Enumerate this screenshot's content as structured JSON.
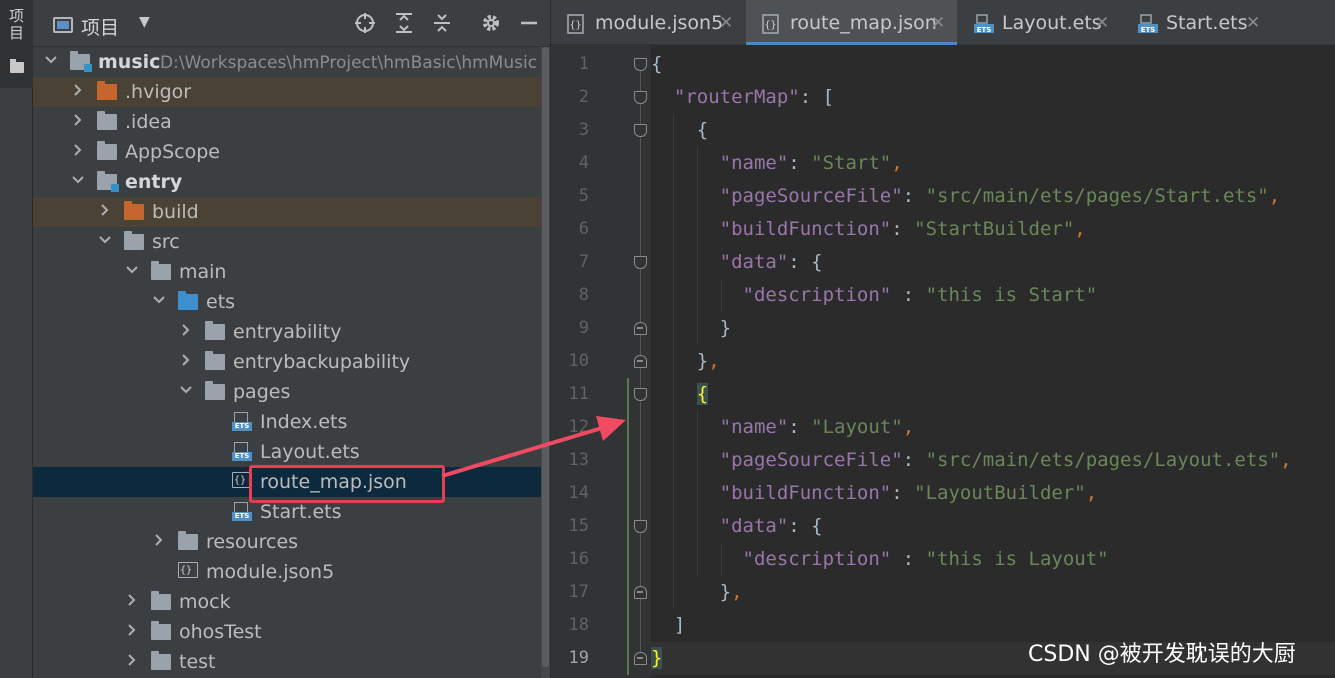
{
  "toolstrip": {
    "project_tab_label": "项目"
  },
  "project_panel": {
    "title": "项目",
    "tree": [
      {
        "label": "music",
        "path": "D:\\Workspaces\\hmProject\\hmBasic\\hmMusic",
        "depth": 0,
        "expanded": true,
        "icon": "module-folder",
        "bold": true
      },
      {
        "label": ".hvigor",
        "depth": 1,
        "expanded": false,
        "icon": "folder-orange"
      },
      {
        "label": ".idea",
        "depth": 1,
        "expanded": false,
        "icon": "folder"
      },
      {
        "label": "AppScope",
        "depth": 1,
        "expanded": false,
        "icon": "folder"
      },
      {
        "label": "entry",
        "depth": 1,
        "expanded": true,
        "icon": "module-folder",
        "bold": true
      },
      {
        "label": "build",
        "depth": 2,
        "expanded": false,
        "icon": "folder-orange"
      },
      {
        "label": "src",
        "depth": 2,
        "expanded": true,
        "icon": "folder"
      },
      {
        "label": "main",
        "depth": 3,
        "expanded": true,
        "icon": "folder"
      },
      {
        "label": "ets",
        "depth": 4,
        "expanded": true,
        "icon": "folder-blue"
      },
      {
        "label": "entryability",
        "depth": 5,
        "expanded": false,
        "icon": "folder"
      },
      {
        "label": "entrybackupability",
        "depth": 5,
        "expanded": false,
        "icon": "folder"
      },
      {
        "label": "pages",
        "depth": 5,
        "expanded": true,
        "icon": "folder"
      },
      {
        "label": "Index.ets",
        "depth": 6,
        "icon": "ets-file"
      },
      {
        "label": "Layout.ets",
        "depth": 6,
        "icon": "ets-file"
      },
      {
        "label": "route_map.json",
        "depth": 6,
        "icon": "json-file",
        "selected": true
      },
      {
        "label": "Start.ets",
        "depth": 6,
        "icon": "ets-file"
      },
      {
        "label": "resources",
        "depth": 4,
        "expanded": false,
        "icon": "folder"
      },
      {
        "label": "module.json5",
        "depth": 4,
        "icon": "json-file"
      },
      {
        "label": "mock",
        "depth": 3,
        "expanded": false,
        "icon": "folder"
      },
      {
        "label": "ohosTest",
        "depth": 3,
        "expanded": false,
        "icon": "folder"
      },
      {
        "label": "test",
        "depth": 3,
        "expanded": false,
        "icon": "folder"
      }
    ]
  },
  "editor": {
    "tabs": [
      {
        "label": "module.json5",
        "icon": "json-file",
        "active": false
      },
      {
        "label": "route_map.json",
        "icon": "json-file",
        "active": true
      },
      {
        "label": "Layout.ets",
        "icon": "ets-file",
        "active": false
      },
      {
        "label": "Start.ets",
        "icon": "ets-file",
        "active": false
      }
    ],
    "lines": [
      {
        "n": "1",
        "segs": [
          [
            "b",
            "{"
          ]
        ]
      },
      {
        "n": "2",
        "segs": [
          [
            "b",
            "  "
          ],
          [
            "k",
            "\"routerMap\""
          ],
          [
            "b",
            ": ["
          ]
        ]
      },
      {
        "n": "3",
        "segs": [
          [
            "b",
            "    {"
          ]
        ]
      },
      {
        "n": "4",
        "segs": [
          [
            "b",
            "      "
          ],
          [
            "k",
            "\"name\""
          ],
          [
            "b",
            ": "
          ],
          [
            "s",
            "\"Start\""
          ],
          [
            "p",
            ","
          ]
        ]
      },
      {
        "n": "5",
        "segs": [
          [
            "b",
            "      "
          ],
          [
            "k",
            "\"pageSourceFile\""
          ],
          [
            "b",
            ": "
          ],
          [
            "s",
            "\"src/main/ets/pages/Start.ets\""
          ],
          [
            "p",
            ","
          ]
        ]
      },
      {
        "n": "6",
        "segs": [
          [
            "b",
            "      "
          ],
          [
            "k",
            "\"buildFunction\""
          ],
          [
            "b",
            ": "
          ],
          [
            "s",
            "\"StartBuilder\""
          ],
          [
            "p",
            ","
          ]
        ]
      },
      {
        "n": "7",
        "segs": [
          [
            "b",
            "      "
          ],
          [
            "k",
            "\"data\""
          ],
          [
            "b",
            ": {"
          ]
        ]
      },
      {
        "n": "8",
        "segs": [
          [
            "b",
            "        "
          ],
          [
            "k",
            "\"description\""
          ],
          [
            "b",
            " : "
          ],
          [
            "s",
            "\"this is Start\""
          ]
        ]
      },
      {
        "n": "9",
        "segs": [
          [
            "b",
            "      }"
          ]
        ]
      },
      {
        "n": "10",
        "segs": [
          [
            "b",
            "    }"
          ],
          [
            "p",
            ","
          ]
        ]
      },
      {
        "n": "11",
        "segs": [
          [
            "b",
            "    "
          ],
          [
            "bm",
            "{"
          ]
        ]
      },
      {
        "n": "12",
        "segs": [
          [
            "b",
            "      "
          ],
          [
            "k",
            "\"name\""
          ],
          [
            "b",
            ": "
          ],
          [
            "s",
            "\"Layout\""
          ],
          [
            "p",
            ","
          ]
        ]
      },
      {
        "n": "13",
        "segs": [
          [
            "b",
            "      "
          ],
          [
            "k",
            "\"pageSourceFile\""
          ],
          [
            "b",
            ": "
          ],
          [
            "s",
            "\"src/main/ets/pages/Layout.ets\""
          ],
          [
            "p",
            ","
          ]
        ]
      },
      {
        "n": "14",
        "segs": [
          [
            "b",
            "      "
          ],
          [
            "k",
            "\"buildFunction\""
          ],
          [
            "b",
            ": "
          ],
          [
            "s",
            "\"LayoutBuilder\""
          ],
          [
            "p",
            ","
          ]
        ]
      },
      {
        "n": "15",
        "segs": [
          [
            "b",
            "      "
          ],
          [
            "k",
            "\"data\""
          ],
          [
            "b",
            ": {"
          ]
        ]
      },
      {
        "n": "16",
        "segs": [
          [
            "b",
            "        "
          ],
          [
            "k",
            "\"description\""
          ],
          [
            "b",
            " : "
          ],
          [
            "s",
            "\"this is Layout\""
          ]
        ]
      },
      {
        "n": "17",
        "segs": [
          [
            "b",
            "      }"
          ],
          [
            "p",
            ","
          ]
        ]
      },
      {
        "n": "18",
        "segs": [
          [
            "b",
            "  ]"
          ]
        ]
      },
      {
        "n": "19",
        "segs": [
          [
            "bm",
            "}"
          ]
        ]
      }
    ]
  },
  "watermark": "CSDN @被开发耽误的大厨",
  "colors": {
    "selection_box": "#e93d52",
    "arrow": "#f04b63",
    "tab_underline": "#4a88c7"
  }
}
